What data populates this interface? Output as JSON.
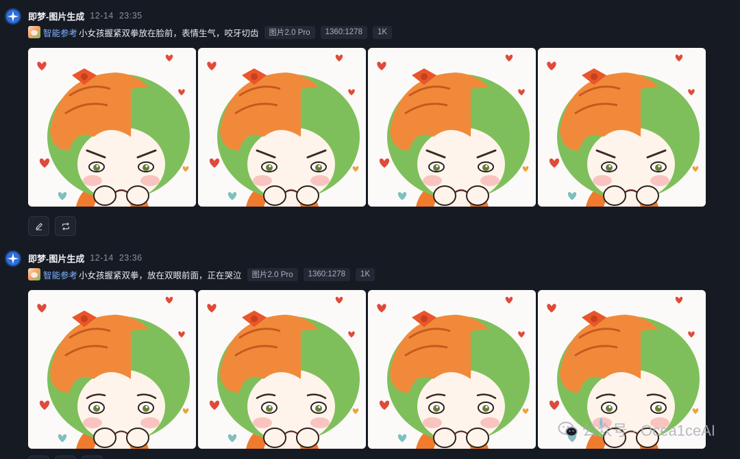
{
  "messages": [
    {
      "sender": "即梦-图片生成",
      "date": "12-14",
      "time": "23:35",
      "smart_ref": "智能参考",
      "prompt": "小女孩握紧双拳放在脸前，表情生气，咬牙切齿",
      "tags": [
        "图片2.0 Pro",
        "1360:1278",
        "1K"
      ],
      "images": [
        {
          "expression": "angry"
        },
        {
          "expression": "angry"
        },
        {
          "expression": "angry"
        },
        {
          "expression": "angry"
        }
      ]
    },
    {
      "sender": "即梦-图片生成",
      "date": "12-14",
      "time": "23:36",
      "smart_ref": "智能参考",
      "prompt": "小女孩握紧双拳，放在双眼前面，正在哭泣",
      "tags": [
        "图片2.0 Pro",
        "1360:1278",
        "1K"
      ],
      "images": [
        {
          "expression": "sad"
        },
        {
          "expression": "sad"
        },
        {
          "expression": "sad"
        },
        {
          "expression": "crying"
        }
      ]
    }
  ],
  "actions": {
    "edit_icon": "pencil-icon",
    "regenerate_icon": "repeat-icon"
  },
  "watermark": {
    "text": "公众号 · Ocea1ceAI",
    "icon": "wechat-icon"
  },
  "colors": {
    "background": "#161a23",
    "accent": "#7fb2ff",
    "hair_orange": "#f08a3a",
    "hair_green": "#7fbf5b",
    "heart_red": "#e04a3a"
  }
}
